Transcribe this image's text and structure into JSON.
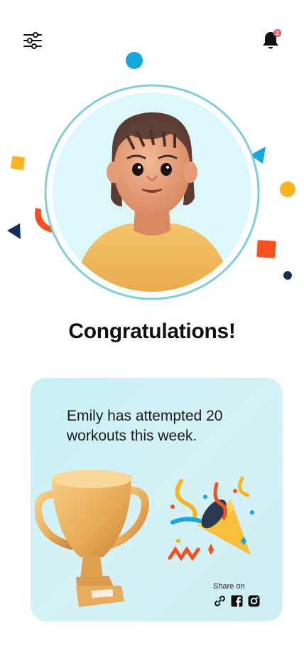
{
  "header": {
    "filter_icon": "sliders-icon",
    "notification_icon": "bell-icon",
    "notification_count": "2"
  },
  "main": {
    "title": "Congratulations!",
    "avatar": "user-avatar-3d"
  },
  "card": {
    "message": "Emily has attempted 20 workouts this week.",
    "trophy": "trophy-icon",
    "party": "party-popper-icon",
    "share_label": "Share on",
    "share_icons": [
      "link-icon",
      "facebook-icon",
      "instagram-icon"
    ]
  },
  "colors": {
    "card_bg": "#c6f1f5",
    "ring": "#7ecfd6",
    "badge": "#ff4d55",
    "confetti_blue": "#15a8de",
    "confetti_yellow": "#f8b51d",
    "confetti_orange": "#f4511e",
    "confetti_navy": "#12315a"
  }
}
